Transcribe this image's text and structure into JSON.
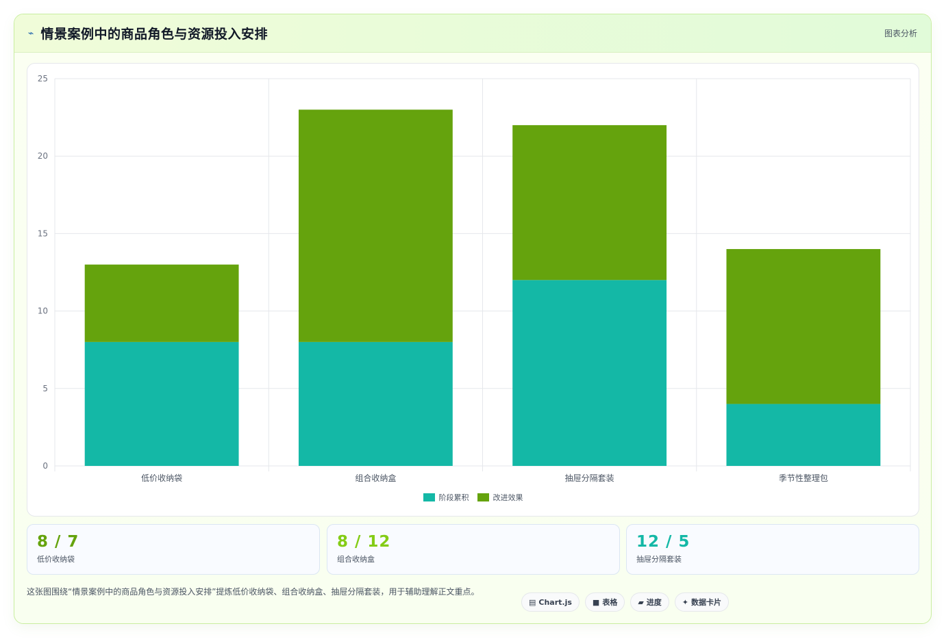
{
  "header": {
    "title_icon": "sparkline-icon",
    "title": "情景案例中的商品角色与资源投入安排",
    "badge": "图表分析"
  },
  "chart_data": {
    "type": "bar",
    "stacked": true,
    "categories": [
      "低价收纳袋",
      "组合收纳盒",
      "抽屉分隔套装",
      "季节性整理包"
    ],
    "series": [
      {
        "name": "阶段累积",
        "color": "#14b8a6",
        "values": [
          8,
          8,
          12,
          4
        ]
      },
      {
        "name": "改进效果",
        "color": "#65a30d",
        "values": [
          5,
          15,
          10,
          10
        ]
      }
    ],
    "ylim": [
      0,
      25
    ],
    "yticks": [
      0,
      5,
      10,
      15,
      20,
      25
    ],
    "grid": true,
    "legend_position": "bottom"
  },
  "stats": [
    {
      "value": "8 / 7",
      "label": "低价收纳袋",
      "color": "#65a30d"
    },
    {
      "value": "8 / 12",
      "label": "组合收纳盒",
      "color": "#84cc16"
    },
    {
      "value": "12 / 5",
      "label": "抽屉分隔套装",
      "color": "#14b8a6"
    }
  ],
  "footnote": "这张图围绕“情景案例中的商品角色与资源投入安排”提炼低价收纳袋、组合收纳盒、抽屉分隔套装，用于辅助理解正文重点。",
  "pills": [
    {
      "icon": "chart-icon",
      "glyph": "▤",
      "label": "Chart.js"
    },
    {
      "icon": "table-icon",
      "glyph": "■",
      "label": "表格"
    },
    {
      "icon": "progress-icon",
      "glyph": "▰",
      "label": "进度"
    },
    {
      "icon": "sparkle-icon",
      "glyph": "✦",
      "label": "数据卡片"
    }
  ]
}
